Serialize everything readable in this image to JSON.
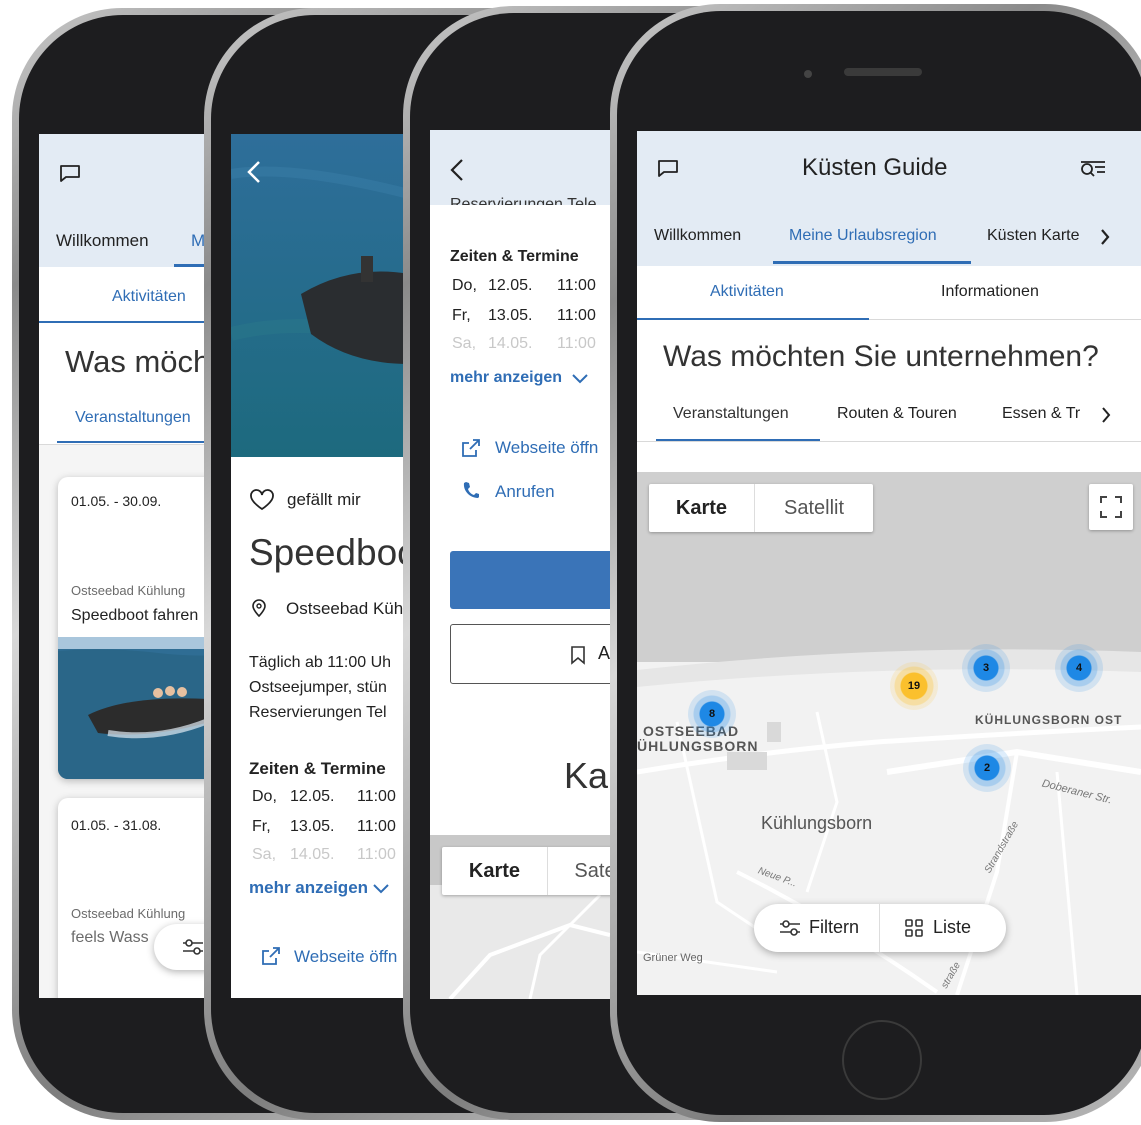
{
  "phone1": {
    "tabs": [
      "Willkommen",
      "M"
    ],
    "subtab": "Aktivitäten",
    "heading": "Was möch",
    "category": "Veranstaltungen",
    "cards": [
      {
        "date": "01.05. - 30.09.",
        "place": "Ostseebad Kühlung",
        "title": "Speedboot fahren"
      },
      {
        "date": "01.05. - 31.08.",
        "place": "Ostseebad Kühlung",
        "title": "feels Wass"
      }
    ]
  },
  "phone2": {
    "like_label": "gefällt mir",
    "title": "Speedboo",
    "location": "Ostseebad Küh",
    "description": [
      "Täglich ab 11:00 Uh",
      "Ostseejumper, stün",
      "Reservierungen Tel"
    ],
    "times_heading": "Zeiten & Termine",
    "times": [
      {
        "day": "Do,",
        "date": "12.05.",
        "time": "11:00"
      },
      {
        "day": "Fr,",
        "date": "13.05.",
        "time": "11:00"
      },
      {
        "day": "Sa,",
        "date": "14.05.",
        "time": "11:00"
      }
    ],
    "more_label": "mehr anzeigen",
    "website_label": "Webseite öffn"
  },
  "phone3": {
    "cut_text": "Reservierungen Tele",
    "times_heading": "Zeiten & Termine",
    "times": [
      {
        "day": "Do,",
        "date": "12.05.",
        "time": "11:00"
      },
      {
        "day": "Fr,",
        "date": "13.05.",
        "time": "11:00"
      },
      {
        "day": "Sa,",
        "date": "14.05.",
        "time": "11:00"
      }
    ],
    "more_label": "mehr anzeigen",
    "website_label": "Webseite öffn",
    "call_label": "Anrufen",
    "bookmark_label": "A",
    "map_heading": "Kar",
    "map_toggle": [
      "Karte",
      "Sate"
    ]
  },
  "phone4": {
    "title": "Küsten Guide",
    "tabs": [
      "Willkommen",
      "Meine Urlaubsregion",
      "Küsten Karte"
    ],
    "subtabs": [
      "Aktivitäten",
      "Informationen"
    ],
    "heading": "Was möchten Sie unternehmen?",
    "categories": [
      "Veranstaltungen",
      "Routen & Touren",
      "Essen & Tr"
    ],
    "map_toggle": [
      "Karte",
      "Satellit"
    ],
    "clusters": [
      "3",
      "4",
      "19",
      "8",
      "2"
    ],
    "map_labels": {
      "ostseebad": "OSTSEEBAD",
      "kuehlungsborn_upper": "ÜHLUNGSBORN",
      "kuehlungsborn_ost": "KÜHLUNGSBORN OST",
      "kuehlungsborn": "Kühlungsborn",
      "doberaner": "Doberaner Str.",
      "neue": "Neue P...",
      "strand": "Strandstraße",
      "gruener": "Grüner Weg",
      "strasse": "straße"
    },
    "filter_label": "Filtern",
    "list_label": "Liste"
  },
  "colors": {
    "accent": "#2f6db5",
    "header_bg": "#e3ebf4",
    "cluster_blue": "#1e88e5",
    "cluster_yellow": "#fbc02d"
  }
}
